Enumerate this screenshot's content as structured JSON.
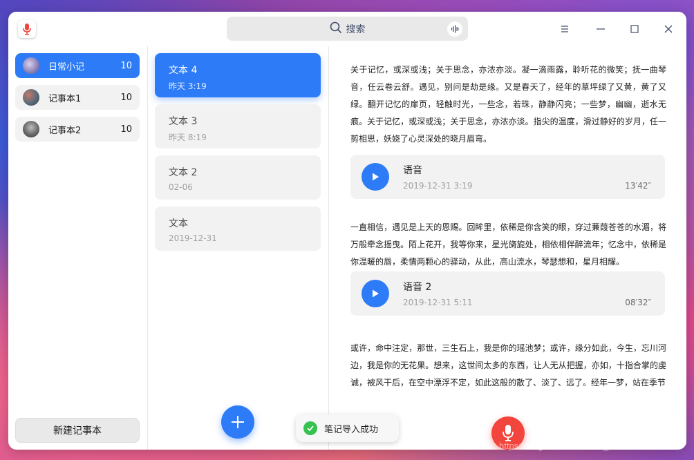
{
  "app": {
    "icon": "microphone-app-icon",
    "accent": "#2d7bf6",
    "record_color": "#f2453d"
  },
  "search": {
    "label": "搜索",
    "icon": "search-icon",
    "voice_icon": "voice-search-icon"
  },
  "window_controls": {
    "menu": "menu-icon",
    "minimize": "minimize-icon",
    "maximize": "maximize-icon",
    "close": "close-icon"
  },
  "sidebar": {
    "notebooks": [
      {
        "name": "日常小记",
        "count": "10",
        "avatar_color": "#8a7fb6",
        "active": true
      },
      {
        "name": "记事本1",
        "count": "10",
        "avatar_color": "#5b6b7a",
        "active": false
      },
      {
        "name": "记事本2",
        "count": "10",
        "avatar_color": "#6a6a6a",
        "active": false
      }
    ],
    "new_notebook_label": "新建记事本"
  },
  "notes": [
    {
      "title": "文本 4",
      "time": "昨天  3:19",
      "active": true
    },
    {
      "title": "文本 3",
      "time": "昨天  8:19",
      "active": false
    },
    {
      "title": "文本 2",
      "time": "02-06",
      "active": false
    },
    {
      "title": "文本",
      "time": "2019-12-31",
      "active": false
    }
  ],
  "editor": {
    "para1": "关于记忆，或深或浅；关于思念，亦浓亦淡。凝一滴雨露，聆听花的微笑；抚一曲琴音，任云卷云舒。遇见，别问是劫是缘。又是春天了，经年的草坪绿了又黄，黄了又绿。翻开记忆的扉页，轻触时光，一些念，若珠，静静闪亮；一些梦，幽幽，逝水无痕。关于记忆，或深或浅；关于思念，亦浓亦淡。指尖的温度，滑过静好的岁月，任一剪相思，妖娆了心灵深处的晓月眉弯。",
    "voice1": {
      "title": "语音",
      "time": "2019-12-31   3:19",
      "duration": "13′42″"
    },
    "para2": "一直相信，遇见是上天的恩赐。回眸里，依稀是你含笑的眼，穿过蒹葭苍苍的水湄，将万般牵念摇曳。陌上花开，我等你来，星光旖旎处，相依相伴醉流年；忆念中，依稀是你温暖的唇，柔情两颗心的驿动，从此，高山流水，琴瑟想和，星月相耀。",
    "voice2": {
      "title": "语音 2",
      "time": "2019-12-31   5:11",
      "duration": "08′32″"
    },
    "para3": "或许，命中注定，那世，三生石上，我是你的瑶池梦；或许，缘分如此，今生，忘川河边，我是你的无花果。想来，这世间太多的东西，让人无从把握，亦如，十指合掌的虔诚，被风干后，在空中漂浮不定，如此这般的散了、淡了、远了。经年一梦，站在季节"
  },
  "toast": {
    "text": "笔记导入成功",
    "icon": "check-circle-icon"
  },
  "watermark": "https://blog.csdn.net/rekiin_43355076"
}
